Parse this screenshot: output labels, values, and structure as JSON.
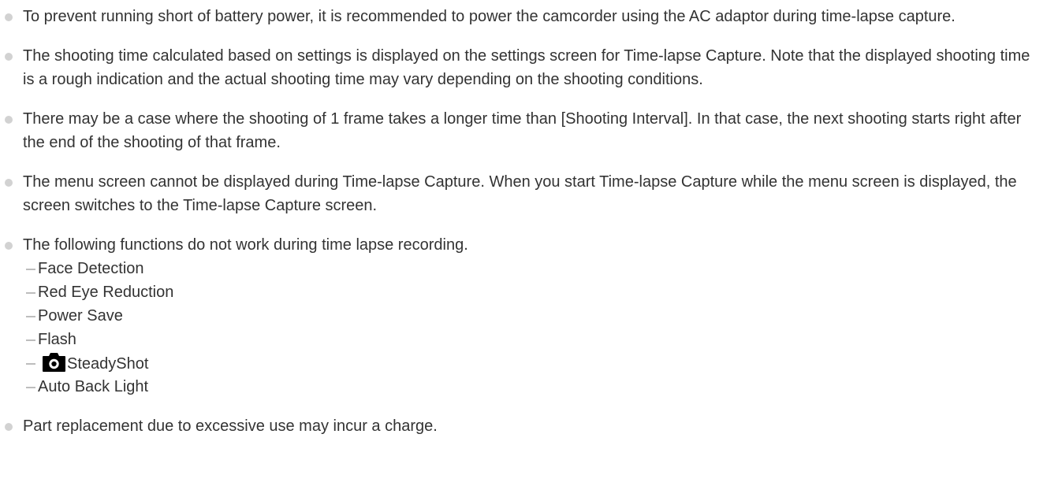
{
  "notes": [
    {
      "text": "To prevent running short of battery power, it is recommended to power the camcorder using the AC adaptor during time-lapse capture."
    },
    {
      "text": "The shooting time calculated based on settings is displayed on the settings screen for Time-lapse Capture. Note that the displayed shooting time is a rough indication and the actual shooting time may vary depending on the shooting conditions."
    },
    {
      "text": "There may be a case where the shooting of 1 frame takes a longer time than [Shooting Interval]. In that case, the next shooting starts right after the end of the shooting of that frame."
    },
    {
      "text": "The menu screen cannot be displayed during Time-lapse Capture. When you start Time-lapse Capture while the menu screen is displayed, the screen switches to the Time-lapse Capture screen."
    },
    {
      "text": "The following functions do not work during time lapse recording.",
      "subitems": [
        {
          "text": "Face Detection"
        },
        {
          "text": "Red Eye Reduction"
        },
        {
          "text": "Power Save"
        },
        {
          "text": "Flash"
        },
        {
          "text": "SteadyShot",
          "icon": "still-camera-icon"
        },
        {
          "text": "Auto Back Light"
        }
      ]
    },
    {
      "text": "Part replacement due to excessive use may incur a charge."
    }
  ],
  "colors": {
    "text": "#333333",
    "bullet": "#d2d2d2",
    "dash": "#bdbdbd",
    "icon_bg": "#000000",
    "icon_fg": "#ffffff"
  }
}
